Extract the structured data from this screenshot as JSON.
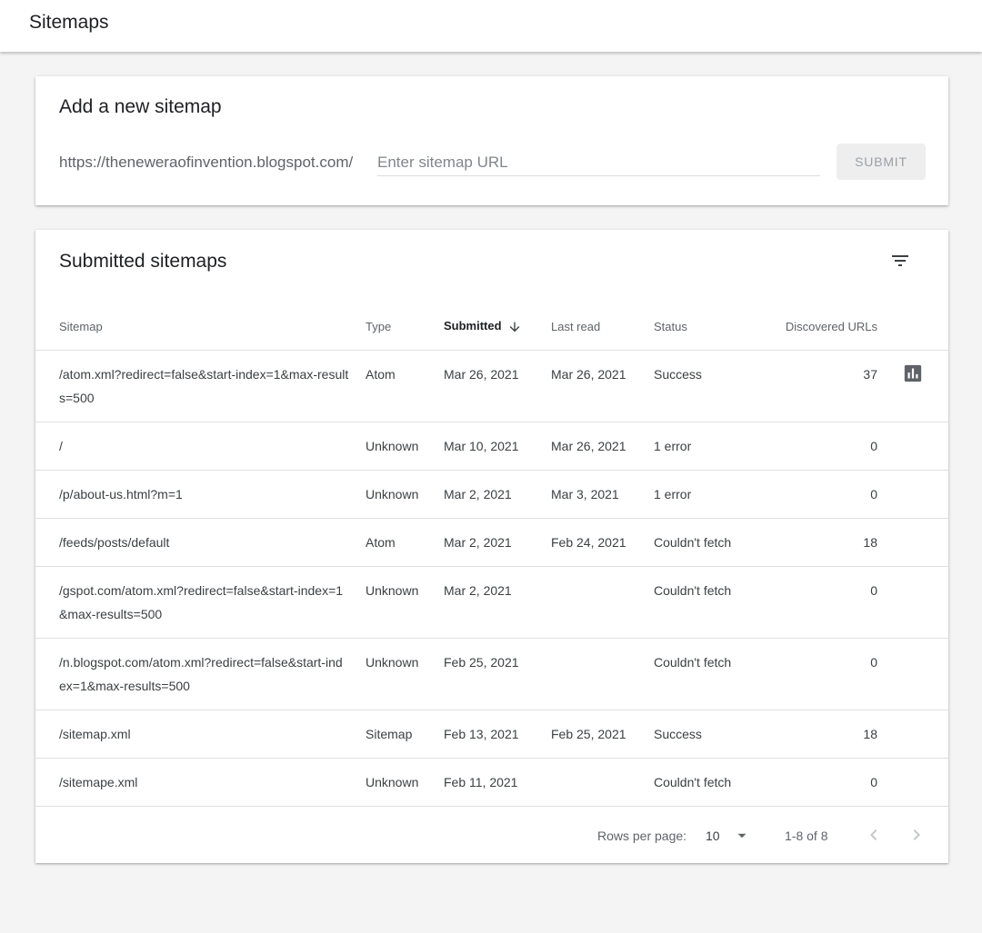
{
  "header": {
    "title": "Sitemaps"
  },
  "add_card": {
    "title": "Add a new sitemap",
    "url_prefix": "https://theneweraofinvention.blogspot.com/",
    "input_value": "",
    "input_placeholder": "Enter sitemap URL",
    "submit_label": "SUBMIT"
  },
  "list_card": {
    "title": "Submitted sitemaps",
    "filter_icon": "filter-list-icon",
    "columns": {
      "sitemap": "Sitemap",
      "type": "Type",
      "submitted": "Submitted",
      "last_read": "Last read",
      "status": "Status",
      "discovered": "Discovered URLs"
    },
    "sort": {
      "column": "submitted",
      "direction": "descending"
    },
    "rows": [
      {
        "sitemap": "/atom.xml?redirect=false&start-index=1&max-results=500",
        "type": "Atom",
        "submitted": "Mar 26, 2021",
        "last_read": "Mar 26, 2021",
        "status": "Success",
        "status_kind": "ok",
        "discovered": "37",
        "has_chart": true
      },
      {
        "sitemap": "/",
        "type": "Unknown",
        "submitted": "Mar 10, 2021",
        "last_read": "Mar 26, 2021",
        "status": "1 error",
        "status_kind": "err",
        "discovered": "0",
        "has_chart": false
      },
      {
        "sitemap": "/p/about-us.html?m=1",
        "type": "Unknown",
        "submitted": "Mar 2, 2021",
        "last_read": "Mar 3, 2021",
        "status": "1 error",
        "status_kind": "err",
        "discovered": "0",
        "has_chart": false
      },
      {
        "sitemap": "/feeds/posts/default",
        "type": "Atom",
        "submitted": "Mar 2, 2021",
        "last_read": "Feb 24, 2021",
        "status": "Couldn't fetch",
        "status_kind": "err",
        "discovered": "18",
        "has_chart": false
      },
      {
        "sitemap": "/gspot.com/atom.xml?redirect=false&start-index=1&max-results=500",
        "type": "Unknown",
        "submitted": "Mar 2, 2021",
        "last_read": "",
        "status": "Couldn't fetch",
        "status_kind": "err",
        "discovered": "0",
        "has_chart": false
      },
      {
        "sitemap": "/n.blogspot.com/atom.xml?redirect=false&start-index=1&max-results=500",
        "type": "Unknown",
        "submitted": "Feb 25, 2021",
        "last_read": "",
        "status": "Couldn't fetch",
        "status_kind": "err",
        "discovered": "0",
        "has_chart": false
      },
      {
        "sitemap": "/sitemap.xml",
        "type": "Sitemap",
        "submitted": "Feb 13, 2021",
        "last_read": "Feb 25, 2021",
        "status": "Success",
        "status_kind": "ok",
        "discovered": "18",
        "has_chart": false
      },
      {
        "sitemap": "/sitemape.xml",
        "type": "Unknown",
        "submitted": "Feb 11, 2021",
        "last_read": "",
        "status": "Couldn't fetch",
        "status_kind": "err",
        "discovered": "0",
        "has_chart": false
      }
    ],
    "pagination": {
      "rows_per_page_label": "Rows per page:",
      "rows_per_page": "10",
      "range": "1-8 of 8"
    }
  },
  "colors": {
    "success": "#188038",
    "error": "#d93025",
    "accent_text": "#202124",
    "muted_text": "#5f6368"
  }
}
